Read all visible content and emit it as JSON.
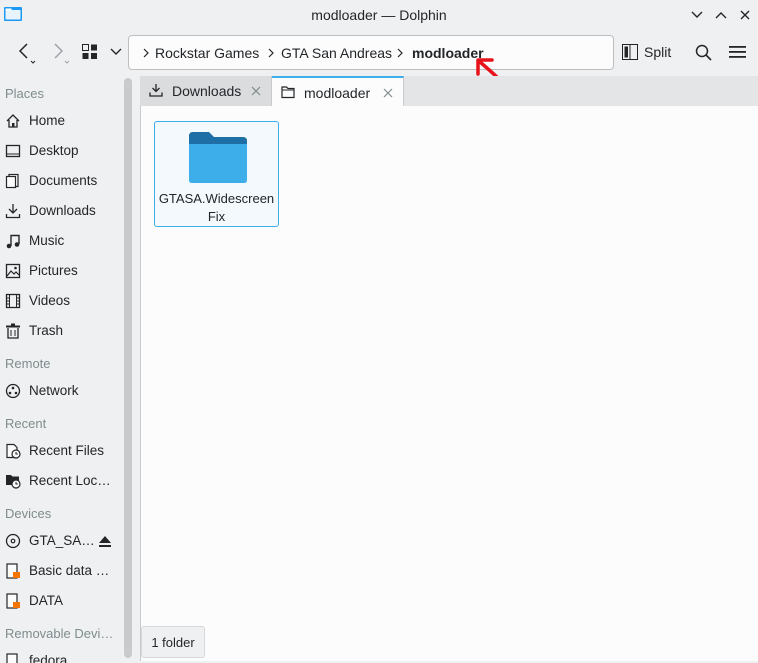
{
  "window": {
    "title": "modloader — Dolphin"
  },
  "toolbar": {
    "breadcrumb": [
      "Rockstar Games",
      "GTA San Andreas",
      "modloader"
    ],
    "split_label": "Split"
  },
  "sidebar": {
    "sections": [
      {
        "title": "Places",
        "items": [
          "Home",
          "Desktop",
          "Documents",
          "Downloads",
          "Music",
          "Pictures",
          "Videos",
          "Trash"
        ]
      },
      {
        "title": "Remote",
        "items": [
          "Network"
        ]
      },
      {
        "title": "Recent",
        "items": [
          "Recent Files",
          "Recent Loc…"
        ]
      },
      {
        "title": "Devices",
        "items": [
          "GTA_SA…",
          "Basic data …",
          "DATA"
        ]
      },
      {
        "title": "Removable Devi…",
        "items": [
          "fedora"
        ]
      }
    ]
  },
  "tabs": [
    {
      "label": "Downloads",
      "icon": "download-icon"
    },
    {
      "label": "modloader",
      "icon": "folder-icon"
    }
  ],
  "content": {
    "items": [
      {
        "name_line1": "GTASA.Widescreen",
        "name_line2": "Fix",
        "icon": "folder-icon"
      }
    ]
  },
  "status": {
    "text": "1 folder"
  },
  "colors": {
    "accent": "#3daee9",
    "folder": "#3daee9",
    "folder_tab": "#1d6fa5",
    "annotation": "#e8121b"
  }
}
